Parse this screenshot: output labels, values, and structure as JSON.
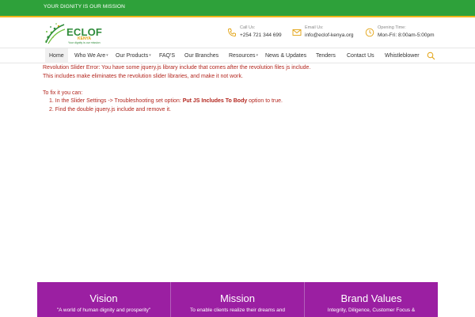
{
  "topbar": {
    "tagline": "YOUR DIGNITY IS OUR MISSION"
  },
  "header": {
    "logo": {
      "name": "ECLOF",
      "sub": "KENYA",
      "tagline": "Your dignity is our mission"
    },
    "contacts": [
      {
        "icon": "phone-icon",
        "label": "Call Us:",
        "value": "+254 721 344 699"
      },
      {
        "icon": "envelope-icon",
        "label": "Email Us:",
        "value": "info@eclof-kenya.org"
      },
      {
        "icon": "clock-icon",
        "label": "Opening Time:",
        "value": "Mon-Fri: 8:00am-5:00pm"
      }
    ]
  },
  "nav": {
    "items": [
      {
        "label": "Home",
        "active": true
      },
      {
        "label": "Who We Are",
        "dropdown": true
      },
      {
        "label": "Our Products",
        "dropdown": true
      },
      {
        "label": "FAQ'S"
      },
      {
        "label": "Our Branches"
      },
      {
        "label": "Resources",
        "dropdown": true
      },
      {
        "label": "News & Updates"
      },
      {
        "label": "Tenders"
      },
      {
        "label": "Contact Us"
      },
      {
        "label": "Whistleblower"
      }
    ]
  },
  "error": {
    "line1": "Revolution Slider Error: You have some jquery.js library include that comes after the revolution files js include.",
    "line2": "This includes make eliminates the revolution slider libraries, and make it not work.",
    "fix_heading": "To fix it you can:",
    "step1_prefix": "1. In the Slider Settings -> Troubleshooting set option: ",
    "step1_bold": "Put JS Includes To Body",
    "step1_suffix": " option to true.",
    "step2": "2. Find the double jquery.js include and remove it."
  },
  "values": [
    {
      "title": "Vision",
      "text": "\"A  world of human dignity and prosperity\""
    },
    {
      "title": "Mission",
      "text": "To enable clients realize their dreams and"
    },
    {
      "title": "Brand Values",
      "text": "Integrity, Diligence, Customer Focus &"
    }
  ],
  "colors": {
    "topbar": "#2ea13a",
    "accent": "#f2b51c",
    "error": "#b3261e",
    "values_bg": "#9b1fa2"
  }
}
